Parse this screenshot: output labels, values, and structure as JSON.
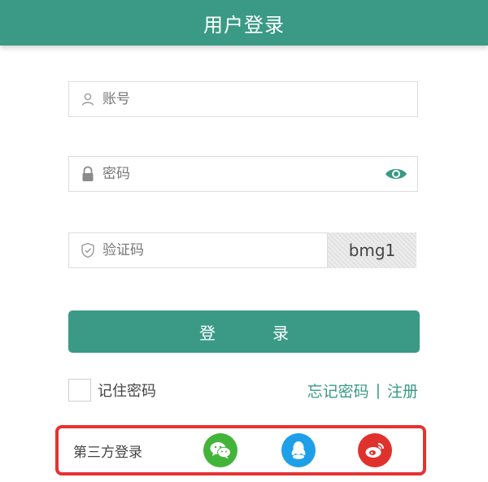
{
  "header": {
    "title": "用户登录"
  },
  "form": {
    "account_placeholder": "账号",
    "password_placeholder": "密码",
    "captcha_placeholder": "验证码",
    "captcha_text": "bmg1"
  },
  "login_button_label": "登录",
  "remember_label": "记住密码",
  "links": {
    "forgot": "忘记密码",
    "separator": "|",
    "register": "注册"
  },
  "third_party": {
    "label": "第三方登录",
    "providers": [
      "wechat-icon",
      "qq-icon",
      "weibo-icon"
    ]
  },
  "colors": {
    "brand": "#3a9a86",
    "highlight_border": "#e53232",
    "wechat": "#43b43a",
    "qq": "#1ea0e8",
    "weibo": "#e0322c"
  }
}
